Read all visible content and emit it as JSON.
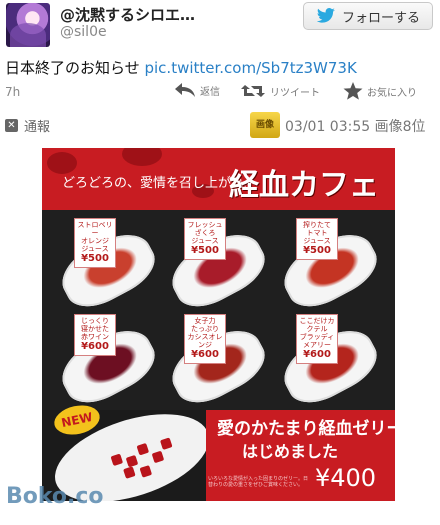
{
  "user": {
    "display_name": "@沈黙するシロエ…",
    "handle": "@sil0e",
    "follow_label": "フォローする"
  },
  "tweet": {
    "text": "日本終了のお知らせ",
    "link": "pic.twitter.com/Sb7tz3W73K",
    "time": "7h"
  },
  "actions": {
    "reply": "返信",
    "retweet": "リツイート",
    "favorite": "お気に入り"
  },
  "meta": {
    "report": "通報",
    "badge": "画像",
    "datetime": "03/01 03:55 画像8位"
  },
  "image": {
    "slogan": "どろどろの、愛情を召し上がれ。",
    "title": "経血カフェ",
    "items": [
      {
        "lines": [
          "ストロベリー",
          "オレンジ",
          "ジュース"
        ],
        "price": "¥500",
        "color": "#c9402e"
      },
      {
        "lines": [
          "フレッシュ",
          "ざくろ",
          "ジュース"
        ],
        "price": "¥500",
        "color": "#a81c2a"
      },
      {
        "lines": [
          "搾りたて",
          "トマト",
          "ジュース"
        ],
        "price": "¥500",
        "color": "#c43423"
      },
      {
        "lines": [
          "じっくり",
          "寝かせた",
          "赤ワイン"
        ],
        "price": "¥600",
        "color": "#6d0f22"
      },
      {
        "lines": [
          "女子力",
          "たっぷり",
          "カシスオレンジ"
        ],
        "price": "¥600",
        "color": "#a3261c"
      },
      {
        "lines": [
          "ここだけカクテル",
          "ブラッディ",
          "メアリー"
        ],
        "price": "¥600",
        "color": "#b4251d"
      }
    ],
    "new_badge": "NEW",
    "jelly_line1": "愛のかたまり経血ゼリー",
    "jelly_line2": "はじめました",
    "jelly_note": "いろいろな愛情が入った固まりのゼリー。日替わりの愛の重さをぜひご賞味ください。",
    "jelly_price": "¥400"
  },
  "watermark": "Boko.co"
}
